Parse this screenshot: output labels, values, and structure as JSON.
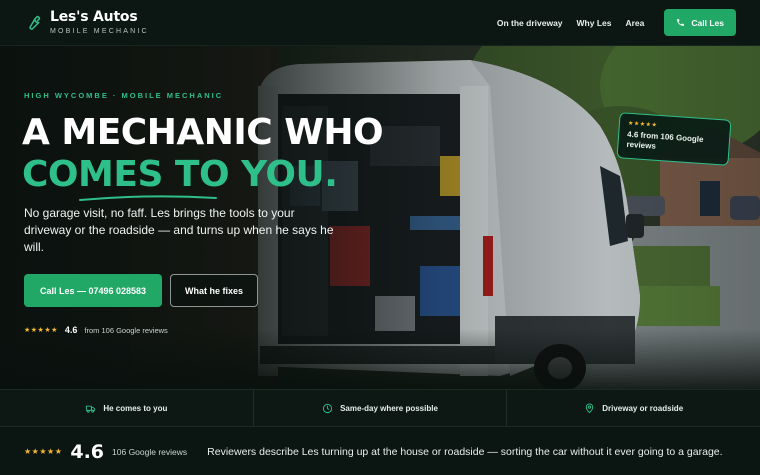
{
  "header": {
    "brand_name": "Les's Autos",
    "brand_sub": "MOBILE MECHANIC",
    "nav": [
      "On the driveway",
      "Why Les",
      "Area"
    ],
    "cta_label": "Call Les"
  },
  "hero": {
    "eyebrow": "HIGH WYCOMBE · MOBILE MECHANIC",
    "headline_line1": "A MECHANIC WHO",
    "headline_line2": "COMES TO YOU.",
    "subtext": "No garage visit, no faff. Les brings the tools to your driveway or the roadside — and turns up when he says he will.",
    "primary_button": "Call Les — 07496 028583",
    "secondary_button": "What he fixes",
    "rating_stars": "★★★★★",
    "rating_value": "4.6",
    "rating_text": "from 106 Google reviews",
    "review_card_stars": "★★★★★",
    "review_card_text": "4.6 from 106 Google reviews"
  },
  "features": [
    {
      "icon": "van-icon",
      "label": "He comes to you"
    },
    {
      "icon": "clock-icon",
      "label": "Same-day where possible"
    },
    {
      "icon": "location-pin-icon",
      "label": "Driveway or roadside"
    }
  ],
  "bottom": {
    "stars": "★★★★★",
    "rating": "4.6",
    "count": "106 Google reviews",
    "quote": "Reviewers describe Les turning up at the house or roadside — sorting the car without it ever going to a garage."
  },
  "colors": {
    "accent": "#2fbf8a",
    "button_green": "#22a866",
    "star": "#f5b82e",
    "background": "#0b1512"
  }
}
